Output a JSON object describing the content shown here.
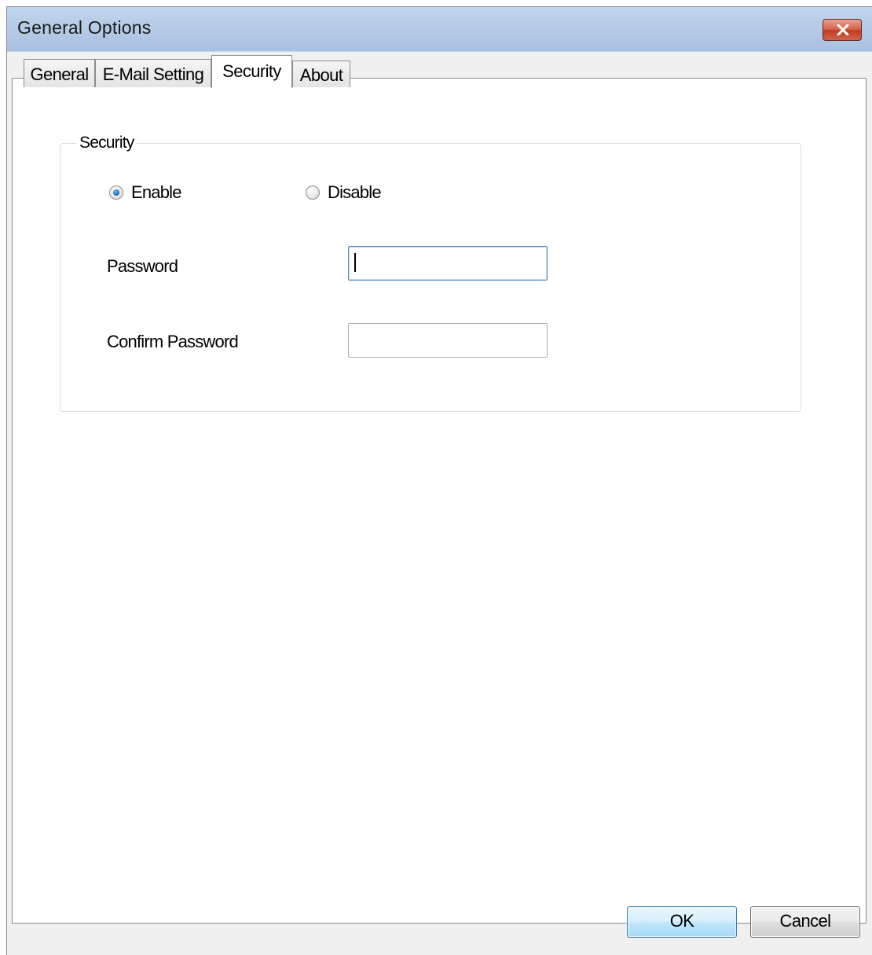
{
  "window": {
    "title": "General Options"
  },
  "tabs": [
    {
      "label": "General",
      "active": false
    },
    {
      "label": "E-Mail Setting",
      "active": false
    },
    {
      "label": "Security",
      "active": true
    },
    {
      "label": "About",
      "active": false
    }
  ],
  "security": {
    "group_title": "Security",
    "enable_label": "Enable",
    "disable_label": "Disable",
    "selected": "Enable",
    "password_label": "Password",
    "password_value": "",
    "confirm_label": "Confirm Password",
    "confirm_value": ""
  },
  "buttons": {
    "ok": "OK",
    "cancel": "Cancel"
  },
  "icons": {
    "close": "close-icon"
  },
  "colors": {
    "close_button": "#c9442b",
    "title_bar": "#b6cbe6",
    "radio_selected": "#1f6fb8",
    "ok_button_border": "#3c7fb1"
  }
}
